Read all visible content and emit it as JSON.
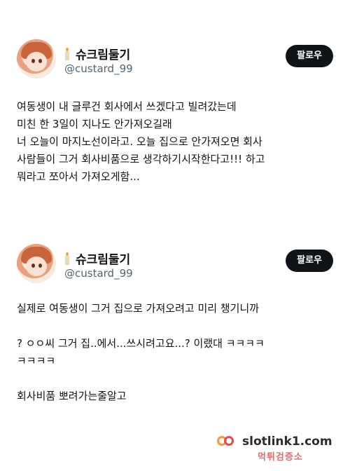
{
  "posts": [
    {
      "display_name": "슈크림둘기",
      "handle": "@custard_99",
      "follow_label": "팔로우",
      "lines": [
        "여동생이 내 글루건 회사에서 쓰겠다고 빌려갔는데",
        "미친 한 3일이 지나도 안가져오길래",
        "너 오늘이 마지노선이라고. 오늘 집으로 안가져오면 회사",
        "사람들이 그거 회사비품으로 생각하기시작한다고!!! 하고",
        "뭐라고 쪼아서 가져오게함..."
      ]
    },
    {
      "display_name": "슈크림둘기",
      "handle": "@custard_99",
      "follow_label": "팔로우",
      "lines": [
        "실제로 여동생이 그거 집으로 가져오려고 미리 챙기니까",
        "",
        "? ㅇㅇ씨 그거 집..에서...쓰시려고요...? 이랬대 ㅋㅋㅋㅋ",
        "ㅋㅋㅋㅋ",
        "",
        "회사비품 뽀려가는줄알고"
      ]
    }
  ],
  "watermark": {
    "text": "slotlink1.com",
    "stamp": "먹튀검증소"
  }
}
